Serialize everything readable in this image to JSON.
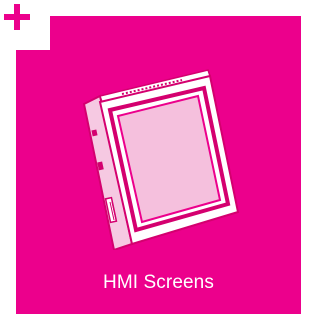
{
  "tile": {
    "label": "HMI Screens",
    "accent_color": "#ec008c",
    "icons": {
      "corner": "plus-icon",
      "illustration": "hmi-panel-icon"
    }
  }
}
